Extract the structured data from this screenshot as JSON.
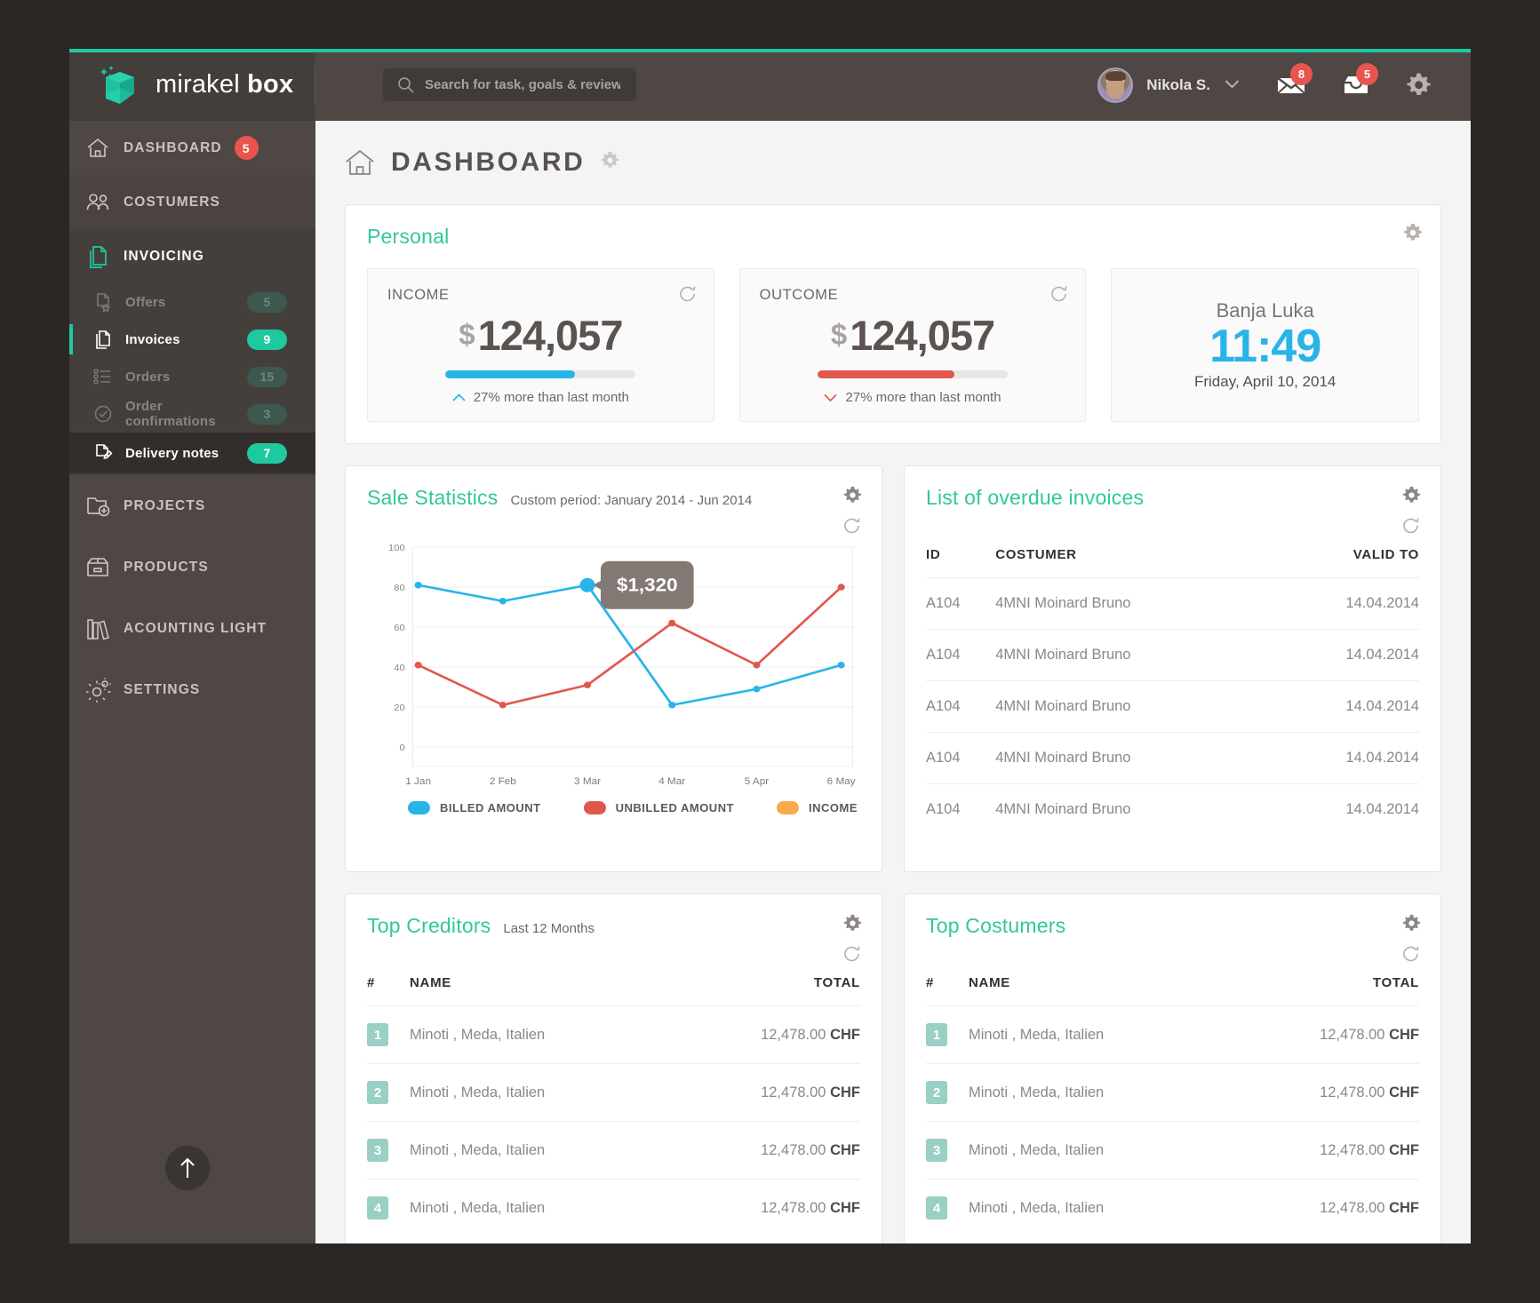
{
  "brand": {
    "name_light": "mirakel",
    "name_bold": "box",
    "logo_icon": "box-logo-icon"
  },
  "search": {
    "placeholder": "Search for task, goals & reviews",
    "value": "",
    "icon": "search-icon"
  },
  "header": {
    "user_name": "Nikola S.",
    "chevron_icon": "chevron-down-icon",
    "mail_icon": "envelope-icon",
    "mail_count": "8",
    "inbox_icon": "inbox-icon",
    "inbox_count": "5",
    "settings_icon": "gear-icon"
  },
  "sidebar": {
    "items": [
      {
        "label": "DASHBOARD",
        "icon": "home-icon",
        "badge": "5",
        "badge_style": "round"
      },
      {
        "label": "COSTUMERS",
        "icon": "users-icon",
        "badge": "",
        "badge_style": "none"
      },
      {
        "label": "INVOICING",
        "icon": "documents-icon",
        "badge": "",
        "badge_style": "none",
        "active": true
      }
    ],
    "sub_items": [
      {
        "label": "Offers",
        "icon": "file-star-icon",
        "badge": "5",
        "state": "dim"
      },
      {
        "label": "Invoices",
        "icon": "file-copy-icon",
        "badge": "9",
        "state": "selected"
      },
      {
        "label": "Orders",
        "icon": "list-icon",
        "badge": "15",
        "state": "dim"
      },
      {
        "label": "Order confirmations",
        "icon": "check-circle-icon",
        "badge": "3",
        "state": "dim"
      },
      {
        "label": "Delivery notes",
        "icon": "file-edit-icon",
        "badge": "7",
        "state": "highlight"
      }
    ],
    "items_bottom": [
      {
        "label": "PROJECTS",
        "icon": "folder-plus-icon"
      },
      {
        "label": "PRODUCTS",
        "icon": "box-icon"
      },
      {
        "label": "ACOUNTING LIGHT",
        "icon": "books-icon"
      },
      {
        "label": "SETTINGS",
        "icon": "gears-icon"
      }
    ],
    "scroll_top_icon": "arrow-up-icon"
  },
  "page": {
    "title": "DASHBOARD",
    "home_icon": "home-outline-icon",
    "gear_icon": "gear-icon"
  },
  "personal": {
    "title": "Personal",
    "gear_icon": "gear-icon",
    "income": {
      "label": "INCOME",
      "currency": "$",
      "value": "124,057",
      "progress": 68,
      "note": "27% more than last month",
      "trend": "up",
      "bar_color": "#29b4e8",
      "refresh_icon": "refresh-icon"
    },
    "outcome": {
      "label": "OUTCOME",
      "currency": "$",
      "value": "124,057",
      "progress": 72,
      "note": "27% more than last month",
      "trend": "down",
      "bar_color": "#e2574c",
      "refresh_icon": "refresh-icon"
    },
    "clock": {
      "city": "Banja Luka",
      "time": "11:49",
      "date": "Friday, April 10, 2014"
    }
  },
  "sale_statistics": {
    "title": "Sale Statistics",
    "subtitle": "Custom period: January 2014 - Jun 2014",
    "gear_icon": "gear-icon",
    "refresh_icon": "refresh-icon"
  },
  "chart_data": {
    "type": "line",
    "title": "Sale Statistics",
    "subtitle": "Custom period: January 2014 - Jun 2014",
    "xlabel": "",
    "ylabel": "",
    "x": [
      "1 Jan",
      "2 Feb",
      "3 Mar",
      "4 Mar",
      "5 Apr",
      "6 May"
    ],
    "yticks": [
      0,
      20,
      40,
      60,
      80,
      100
    ],
    "ylim": [
      0,
      100
    ],
    "grid": true,
    "legend_position": "bottom",
    "series": [
      {
        "name": "BILLED AMOUNT",
        "color": "#29b4e8",
        "values": [
          81,
          73,
          81,
          21,
          29,
          41
        ]
      },
      {
        "name": "UNBILLED AMOUNT",
        "color": "#e2574c",
        "values": [
          41,
          21,
          31,
          62,
          41,
          80
        ]
      },
      {
        "name": "INCOME",
        "color": "#f9ab4b",
        "values": []
      }
    ],
    "annotation": {
      "text": "$1,320",
      "series": "BILLED AMOUNT",
      "x": "3 Mar",
      "y": 81
    }
  },
  "overdue": {
    "title": "List of overdue invoices",
    "gear_icon": "gear-icon",
    "refresh_icon": "refresh-icon",
    "columns": [
      "ID",
      "COSTUMER",
      "VALID TO"
    ],
    "rows": [
      [
        "A104",
        "4MNI Moinard Bruno",
        "14.04.2014"
      ],
      [
        "A104",
        "4MNI Moinard Bruno",
        "14.04.2014"
      ],
      [
        "A104",
        "4MNI Moinard Bruno",
        "14.04.2014"
      ],
      [
        "A104",
        "4MNI Moinard Bruno",
        "14.04.2014"
      ],
      [
        "A104",
        "4MNI Moinard Bruno",
        "14.04.2014"
      ]
    ]
  },
  "top_creditors": {
    "title": "Top Creditors",
    "subtitle": "Last 12 Months",
    "gear_icon": "gear-icon",
    "refresh_icon": "refresh-icon",
    "columns": [
      "#",
      "NAME",
      "TOTAL"
    ],
    "rows": [
      [
        "1",
        "Minoti , Meda, Italien",
        "12,478.00",
        "CHF"
      ],
      [
        "2",
        "Minoti , Meda, Italien",
        "12,478.00",
        "CHF"
      ],
      [
        "3",
        "Minoti , Meda, Italien",
        "12,478.00",
        "CHF"
      ],
      [
        "4",
        "Minoti , Meda, Italien",
        "12,478.00",
        "CHF"
      ]
    ]
  },
  "top_costumers": {
    "title": "Top Costumers",
    "subtitle": "",
    "gear_icon": "gear-icon",
    "refresh_icon": "refresh-icon",
    "columns": [
      "#",
      "NAME",
      "TOTAL"
    ],
    "rows": [
      [
        "1",
        "Minoti , Meda, Italien",
        "12,478.00",
        "CHF"
      ],
      [
        "2",
        "Minoti , Meda, Italien",
        "12,478.00",
        "CHF"
      ],
      [
        "3",
        "Minoti , Meda, Italien",
        "12,478.00",
        "CHF"
      ],
      [
        "4",
        "Minoti , Meda, Italien",
        "12,478.00",
        "CHF"
      ]
    ]
  },
  "colors": {
    "accent": "#1ec9a0",
    "blue": "#29b4e8",
    "red": "#e2574c",
    "orange": "#f9ab4b",
    "sidebar": "#4e4744",
    "badge_red": "#e9544f"
  }
}
